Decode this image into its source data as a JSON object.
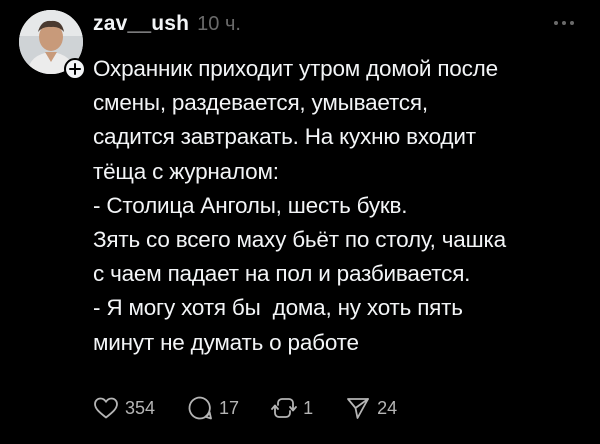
{
  "post": {
    "username": "zav__ush",
    "time": "10 ч.",
    "text": "Охранник приходит утром домой после\nсмены, раздевается, умывается,\nсадится завтракать. На кухню входит\nтёща с журналом:\n- Столица Анголы, шесть букв.\nЗять со всего маху бьёт по столу, чашка\nс чаем падает на пол и разбивается.\n- Я могу хотя бы  дома, ну хоть пять\nминут не думать о работе",
    "avatar_icon": "user-photo",
    "follow_icon": "plus-icon",
    "more_icon": "more-icon"
  },
  "actions": {
    "likes": "354",
    "replies": "17",
    "reposts": "1",
    "shares": "24"
  },
  "colors": {
    "background": "#000000",
    "text": "#f3f5f7",
    "muted": "#6a6a6a",
    "icon": "#b5b5b5"
  }
}
